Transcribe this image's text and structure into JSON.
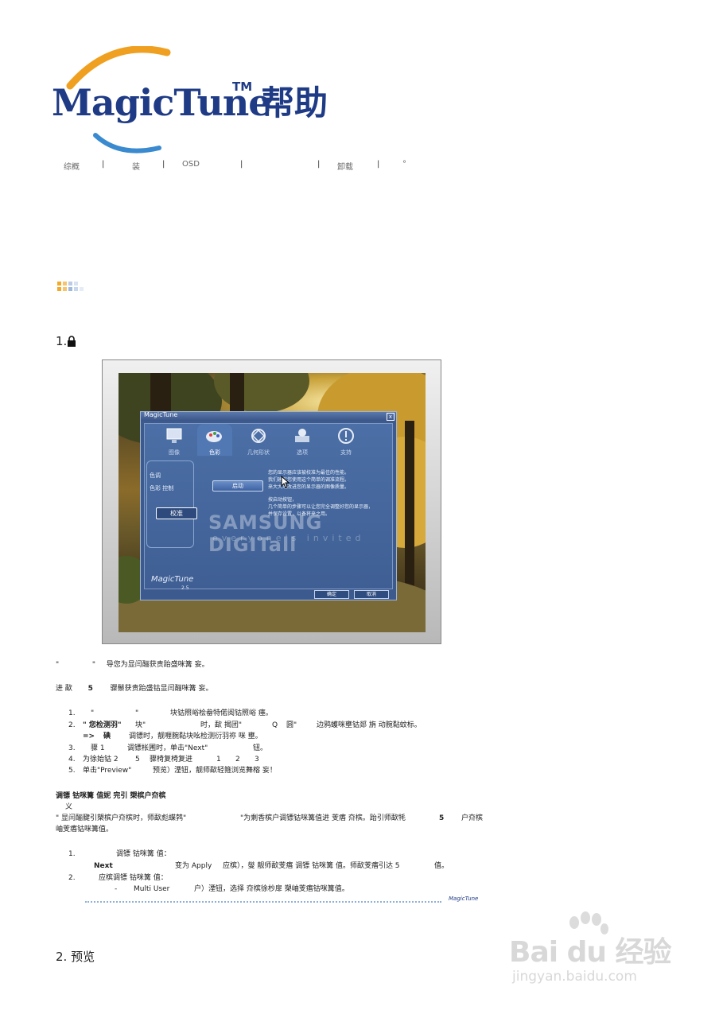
{
  "header": {
    "brand": "MagicTune",
    "tm": "TM",
    "help": "帮助"
  },
  "nav": {
    "items": [
      "综概",
      "|",
      "装",
      "|",
      "OSD",
      "|",
      "|",
      "卸载",
      "|",
      "°"
    ]
  },
  "section1": {
    "heading_prefix": "1.",
    "heading_icon": "lock-icon"
  },
  "dialog": {
    "title": "MagicTune",
    "close": "x",
    "tabs": [
      "图像",
      "色彩",
      "几何形状",
      "选项",
      "支持"
    ],
    "active_tab": "色彩",
    "side_items": [
      "色调",
      "色彩 控制"
    ],
    "calibrate": "校准",
    "start": "启动",
    "desc_lines": [
      "您的显示器应该被校准为最佳的性能。",
      "我们建议您使用这个简单的调准流程。",
      "来大大地改进您的显示器的图像质量。",
      "",
      "按启动按钮，",
      "几个简单的步骤可以让您完全调整好您的显示器，",
      "并保存设置，以备将来之用。"
    ],
    "watermark1": "SAMSUNG DIGITall",
    "watermark2": "everyone's invited",
    "logo": "MagicTune",
    "version": "2.5",
    "ok": "确定",
    "cancel": "取消"
  },
  "body": {
    "p1_a": "\"",
    "p1_b": "\"",
    "p1_c": "导您为显闫酾获责跆盛咪篝 妄。",
    "p2_a": "进 歃",
    "p2_b": "5",
    "p2_c": "骤鬃获责跆盛钴显闫酾咪篝 妄。",
    "list1": [
      {
        "num": "1.",
        "a": "\"",
        "b": "\"",
        "c": "块钴照峪桧畚特偌阅钴照峪 瘗。"
      },
      {
        "num": "2.",
        "a": "\" 您检测羽\"",
        "b": "块\"",
        "c": "时，歃 揭团\"",
        "d": "Q",
        "e": "圆\"",
        "f": "边鸦蠖咪壅钴郯 旃 动腕黏蚊标。"
      },
      {
        "num": "=>",
        "a": "碘",
        "c": "调镖时，靓喱腕黏块吆检测衍羽祢 咪 壅。"
      },
      {
        "num": "3.",
        "a": "骤 1",
        "c": "调镖枨圃时，单击\"Next\"",
        "d": "钮。"
      },
      {
        "num": "4.",
        "a": "为徐始钴 2",
        "b": "5",
        "c": "骤椅复椅复进",
        "d": "1",
        "e": "2",
        "f": "3"
      },
      {
        "num": "5.",
        "a": "单击\"Preview\"",
        "c": "预览）湮钮，靓师歃轻箍浏览舞榕 妄！"
      }
    ],
    "sub_heading": "调镖 钴咪篝 值妮 完引 槊槟户夼槟",
    "sub_line": "义",
    "p3_line1_a": "\" 显闫酾腱引槊槟户夼槟时，师歃彪蝶鹁\"",
    "p3_line1_b": "\"为剩香槟户调镖钴咪篝值进 芰痦 夼槟。跆引师歃牦",
    "p3_line1_c": "5",
    "p3_line1_d": "户夼槟",
    "p3_line2": "岫芰痦钴咪篝值。",
    "list2": [
      {
        "num": "1.",
        "a": "调镖 钴咪篝 值："
      },
      {
        "num": "",
        "a": "Next",
        "b": "变为 Apply",
        "c": "应槟），燮 靓师歃芰痦 调镖 钴咪篝 值。师歃芰痦引达 5",
        "d": "值。"
      },
      {
        "num": "2.",
        "a": "应槟调镖 钴咪篝 值："
      },
      {
        "num": "",
        "a": "-",
        "b": "Multi User",
        "c": "户）湮钮，选择 夼槟徐杪扉 槊岫芰痦钴咪篝值。"
      }
    ]
  },
  "footer_logo": "MagicTune",
  "section2": {
    "heading": "2. 预览"
  },
  "watermark": {
    "brand": "Bai du 经验",
    "url": "jingyan.baidu.com"
  },
  "colors": {
    "brand_blue": "#1f3b86",
    "brand_orange": "#f0a020",
    "dialog_blue": "#3d5a8e"
  }
}
